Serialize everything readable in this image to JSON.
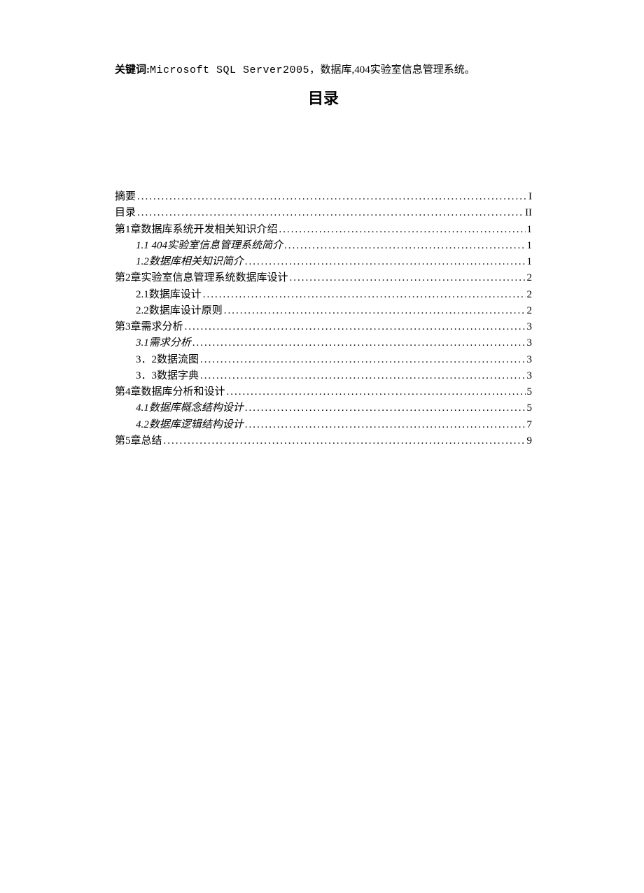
{
  "keywords": {
    "label": "关键词:",
    "tech": "Microsoft SQL Server2005，",
    "rest": "数据库,404实验室信息管理系统。"
  },
  "title": "目录",
  "toc": [
    {
      "label": "摘要",
      "page": "I",
      "indent": 0,
      "italic": false
    },
    {
      "label": "目录",
      "page": "II",
      "indent": 0,
      "italic": false
    },
    {
      "label": "第1章数据库系统开发相关知识介绍",
      "page": "1",
      "indent": 0,
      "italic": false
    },
    {
      "label": "1.1 404实验室信息管理系统简介",
      "page": "1",
      "indent": 1,
      "italic": true
    },
    {
      "label": "1.2数据库相关知识简介",
      "page": "1",
      "indent": 1,
      "italic": true
    },
    {
      "label": "第2章实验室信息管理系统数据库设计",
      "page": "2",
      "indent": 0,
      "italic": false
    },
    {
      "label": "2.1数据库设计",
      "page": "2",
      "indent": 1,
      "italic": false
    },
    {
      "label": "2.2数据库设计原则",
      "page": "2",
      "indent": 1,
      "italic": false
    },
    {
      "label": "第3章需求分析",
      "page": "3",
      "indent": 0,
      "italic": false
    },
    {
      "label": "3.1需求分析",
      "page": "3",
      "indent": 1,
      "italic": true
    },
    {
      "label": "3．2数据流图",
      "page": "3",
      "indent": 1,
      "italic": false
    },
    {
      "label": "3．3数据字典",
      "page": "3",
      "indent": 1,
      "italic": false
    },
    {
      "label": "第4章数据库分析和设计",
      "page": "5",
      "indent": 0,
      "italic": false
    },
    {
      "label": "4.1数据库概念结构设计",
      "page": "5",
      "indent": 1,
      "italic": true
    },
    {
      "label": "4.2数据库逻辑结构设计",
      "page": "7",
      "indent": 1,
      "italic": true
    },
    {
      "label": "第5章总结",
      "page": "9",
      "indent": 0,
      "italic": false
    }
  ]
}
